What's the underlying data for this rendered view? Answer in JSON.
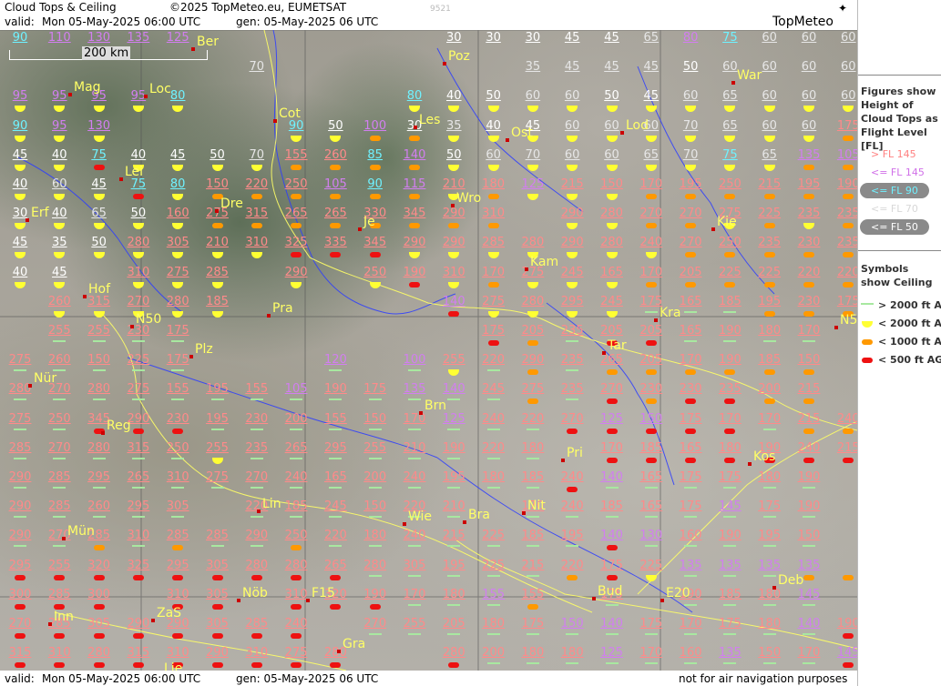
{
  "header": {
    "title": "Cloud Tops & Ceiling",
    "copyright": "©2025 TopMeteo.eu, EUMETSAT",
    "valid_label": "valid:",
    "valid_value": "Mon   05-May-2025  06:00 UTC",
    "gen": "gen: 05-May-2025 06 UTC",
    "code": "9521",
    "logo": "TopMeteo"
  },
  "footer": {
    "valid_label": "valid:",
    "valid_value": "Mon   05-May-2025   06:00 UTC",
    "gen": "gen: 05-May-2025 06 UTC",
    "disclaimer": "not for air navigation purposes"
  },
  "scale": {
    "label": "200 km"
  },
  "legend": {
    "fig_title": "Figures show Height of Cloud Tops as Flight Level  [FL]",
    "fl_entries": [
      {
        "label": "> FL 145",
        "color": "#ff8080",
        "pill": false
      },
      {
        "label": "<= FL 145",
        "color": "#d070e8",
        "pill": false
      },
      {
        "label": "<= FL 90",
        "color": "#70f0ff",
        "pill": true
      },
      {
        "label": "<= FL 70",
        "color": "#d8d8d8",
        "pill": false
      },
      {
        "label": "<= FL 50",
        "color": "#ffffff",
        "pill": true
      }
    ],
    "sym_title": "Symbols show Ceiling",
    "sym_entries": [
      {
        "label": "> 2000 ft AGL",
        "cls": "ge2000"
      },
      {
        "label": "< 2000 ft AGL",
        "cls": "lt2000"
      },
      {
        "label": "< 1000 ft AGL",
        "cls": "lt1000"
      },
      {
        "label": "< 500 ft AGL",
        "cls": "lt500"
      }
    ]
  },
  "colors": {
    "gt145": "#ff8a8a",
    "le145": "#d27ef0",
    "le90": "#6ff2ff",
    "le70": "#e6e6e6",
    "le50": "#ffffff",
    "city": "#ffff66"
  },
  "cities": [
    "Ber",
    "Poz",
    "War",
    "Mag",
    "Loc",
    "Cot",
    "Les",
    "Lod",
    "Ost",
    "Lei",
    "Wro",
    "Dre",
    "Je",
    "Kie",
    "Erf",
    "Kam",
    "Hof",
    "Pra",
    "Kra",
    "N50",
    "Plz",
    "Tar",
    "Nür",
    "Brn",
    "Reg",
    "Pri",
    "Kos",
    "Lin",
    "Mün",
    "Nit",
    "Wie",
    "Bra",
    "Deb",
    "Inn",
    "Nöb",
    "F15",
    "Bud",
    "E20",
    "ZaS",
    "Gra",
    "Lje",
    "N5"
  ],
  "grid_rows": [
    [
      "90 c",
      "110 p",
      "130 p",
      "135 p",
      "125 p",
      "",
      "",
      "",
      "",
      "",
      "",
      "30 w",
      "30 w",
      "30 w",
      "45 w",
      "45 w",
      "65 g",
      "80 p",
      "75 c",
      "60 g",
      "60 g",
      "60 g"
    ],
    [
      "",
      "",
      "",
      "",
      "",
      "",
      "70 g",
      "",
      "",
      "",
      "",
      "",
      "",
      "35 g",
      "45 g",
      "45 g",
      "45 g",
      "50 w",
      "60 g",
      "60 g",
      "60 g",
      "60 g"
    ],
    [
      "95 p",
      "95 p",
      "95 p",
      "95 p",
      "80 c",
      "",
      "",
      "",
      "",
      "",
      "80 c",
      "40 w",
      "50 w",
      "60 g",
      "60 g",
      "50 w",
      "45 w",
      "60 g",
      "65 g",
      "60 g",
      "60 g",
      "60 g"
    ],
    [
      "90 c",
      "95 p",
      "130 p",
      "",
      "",
      "",
      "",
      "90 c",
      "50 w",
      "100 p",
      "30 w",
      "35 g",
      "40 w",
      "45 w",
      "60 g",
      "60 g",
      "60 g",
      "70 g",
      "65 g",
      "60 g",
      "60 g",
      "175 r"
    ],
    [
      "45 w",
      "40 w",
      "75 c",
      "40 w",
      "45 w",
      "50 w",
      "70 g",
      "155 r",
      "260 r",
      "85 c",
      "140 p",
      "50 w",
      "60 g",
      "70 g",
      "60 g",
      "60 g",
      "65 g",
      "70 g",
      "75 c",
      "65 g",
      "135 p",
      "105 p"
    ],
    [
      "40 w",
      "60 g",
      "45 w",
      "75 c",
      "80 c",
      "150 r",
      "220 r",
      "250 r",
      "105 p",
      "90 c",
      "115 p",
      "210 r",
      "180 r",
      "125 p",
      "215 r",
      "150 r",
      "170 r",
      "195 r",
      "250 r",
      "215 r",
      "195 r",
      "190 r"
    ],
    [
      "30 w",
      "40 w",
      "65 g",
      "50 w",
      "160 r",
      "275 r",
      "315 r",
      "265 r",
      "265 r",
      "330 r",
      "345 r",
      "290 r",
      "310 r",
      "",
      "290 r",
      "280 r",
      "270 r",
      "270 r",
      "275 r",
      "225 r",
      "235 r",
      "235 r"
    ],
    [
      "45 w",
      "35 w",
      "50 w",
      "280 r",
      "305 r",
      "210 r",
      "310 r",
      "325 r",
      "335 r",
      "345 r",
      "290 r",
      "290 r",
      "285 r",
      "280 r",
      "290 r",
      "280 r",
      "240 r",
      "270 r",
      "250 r",
      "235 r",
      "230 r",
      "235 r"
    ],
    [
      "40 w",
      "45 w",
      "",
      "310 r",
      "275 r",
      "285 r",
      "",
      "290 r",
      "",
      "250 r",
      "190 r",
      "310 r",
      "170 r",
      "275 r",
      "245 r",
      "165 r",
      "170 r",
      "205 r",
      "225 r",
      "225 r",
      "220 r",
      "220 r"
    ],
    [
      "",
      "260 r",
      "315 r",
      "270 r",
      "280 r",
      "185 r",
      "",
      "",
      "",
      "",
      "",
      "140 p",
      "275 r",
      "280 r",
      "295 r",
      "245 r",
      "175 r",
      "165 r",
      "185 r",
      "195 r",
      "230 r",
      "175 r"
    ],
    [
      "",
      "255 r",
      "255 r",
      "230 r",
      "175 r",
      "",
      "",
      "",
      "",
      "",
      "",
      "",
      "175 r",
      "205 r",
      "235 r",
      "205 r",
      "205 r",
      "165 r",
      "190 r",
      "180 r",
      "170 r",
      ""
    ],
    [
      "275 r",
      "260 r",
      "150 r",
      "225 r",
      "175 r",
      "",
      "",
      "",
      "120 p",
      "",
      "100 p",
      "255 r",
      "220 r",
      "290 r",
      "235 r",
      "265 r",
      "205 r",
      "170 r",
      "190 r",
      "185 r",
      "150 r",
      ""
    ],
    [
      "280 r",
      "270 r",
      "280 r",
      "275 r",
      "155 r",
      "195 r",
      "155 r",
      "105 p",
      "190 r",
      "175 r",
      "135 p",
      "140 p",
      "245 r",
      "275 r",
      "235 r",
      "270 r",
      "230 r",
      "230 r",
      "235 r",
      "200 r",
      "215 r",
      ""
    ],
    [
      "275 r",
      "250 r",
      "345 r",
      "290 r",
      "230 r",
      "195 r",
      "230 r",
      "200 r",
      "155 r",
      "150 r",
      "170 r",
      "125 p",
      "240 r",
      "220 r",
      "270 r",
      "125 p",
      "150 p",
      "175 r",
      "170 r",
      "170 r",
      "215 r",
      "240 r"
    ],
    [
      "285 r",
      "270 r",
      "280 r",
      "315 r",
      "250 r",
      "255 r",
      "235 r",
      "265 r",
      "295 r",
      "255 r",
      "210 r",
      "190 r",
      "220 r",
      "180 r",
      "",
      "170 r",
      "185 r",
      "165 r",
      "180 r",
      "190 r",
      "240 r",
      "215 r"
    ],
    [
      "290 r",
      "285 r",
      "295 r",
      "265 r",
      "310 r",
      "275 r",
      "270 r",
      "240 r",
      "165 r",
      "200 r",
      "240 r",
      "195 r",
      "180 r",
      "185 r",
      "240 r",
      "140 p",
      "165 r",
      "175 r",
      "175 r",
      "180 r",
      "190 r",
      ""
    ],
    [
      "290 r",
      "285 r",
      "260 r",
      "295 r",
      "305 r",
      "",
      "220 r",
      "185 r",
      "245 r",
      "150 r",
      "220 r",
      "210 r",
      "",
      "170 r",
      "240 r",
      "185 r",
      "165 r",
      "175 r",
      "145 p",
      "175 r",
      "190 r",
      ""
    ],
    [
      "290 r",
      "270 r",
      "285 r",
      "310 r",
      "285 r",
      "285 r",
      "290 r",
      "250 r",
      "220 r",
      "180 r",
      "240 r",
      "215 r",
      "225 r",
      "185 r",
      "195 r",
      "140 p",
      "130 p",
      "160 r",
      "190 r",
      "195 r",
      "150 r",
      ""
    ],
    [
      "295 r",
      "255 r",
      "320 r",
      "325 r",
      "295 r",
      "305 r",
      "280 r",
      "280 r",
      "265 r",
      "280 r",
      "305 r",
      "195 r",
      "225 r",
      "215 r",
      "220 r",
      "175 r",
      "225 r",
      "135 p",
      "135 p",
      "135 p",
      "135 p",
      ""
    ],
    [
      "300 r",
      "285 r",
      "300 r",
      "",
      "310 r",
      "305 r",
      "",
      "310 r",
      "320 r",
      "190 r",
      "170 r",
      "180 r",
      "155 p",
      "155 r",
      "",
      "175 r",
      "",
      "190 r",
      "185 r",
      "180 r",
      "145 p",
      ""
    ],
    [
      "270 r",
      "285 r",
      "305 r",
      "290 r",
      "290 r",
      "305 r",
      "285 r",
      "240 r",
      "",
      "270 r",
      "255 r",
      "205 r",
      "180 r",
      "175 r",
      "150 p",
      "140 p",
      "175 r",
      "170 r",
      "175 r",
      "180 r",
      "140 p",
      "190 r"
    ],
    [
      "315 r",
      "310 r",
      "280 r",
      "315 r",
      "310 r",
      "290 r",
      "310 r",
      "275 r",
      "280 r",
      "",
      "",
      "280 r",
      "200 r",
      "180 r",
      "180 r",
      "125 p",
      "170 r",
      "160 r",
      "135 p",
      "150 r",
      "170 r",
      "145 p"
    ]
  ],
  "grid_symbols": [
    "",
    "",
    "",
    "",
    "",
    "",
    "",
    "",
    "",
    "",
    "",
    "",
    "",
    "",
    "",
    "",
    "",
    "",
    "",
    "",
    "",
    "",
    "",
    "",
    "",
    "",
    "",
    "",
    "",
    "",
    "",
    "",
    "",
    "",
    "",
    "",
    "",
    "",
    "",
    "",
    "",
    "",
    "",
    "",
    "y",
    "y",
    "y",
    "y",
    "y",
    "",
    "",
    "",
    "",
    "",
    "y",
    "y",
    "y",
    "y",
    "y",
    "y",
    "y",
    "y",
    "y",
    "y",
    "y",
    "y",
    "y",
    "y",
    "y",
    "",
    "",
    "",
    "",
    "y",
    "y",
    "o",
    "o",
    "y",
    "y",
    "y",
    "y",
    "y",
    "y",
    "y",
    "y",
    "y",
    "y",
    "o",
    "y",
    "y",
    "r",
    "y",
    "y",
    "y",
    "y",
    "o",
    "o",
    "o",
    "o",
    "y",
    "y",
    "y",
    "y",
    "y",
    "y",
    "y",
    "y",
    "y",
    "o",
    "o",
    "y",
    "y",
    "y",
    "r",
    "y",
    "o",
    "o",
    "o",
    "o",
    "o",
    "o",
    "y",
    "o",
    "y",
    "y",
    "y",
    "o",
    "o",
    "o",
    "o",
    "o",
    "o",
    "y",
    "y",
    "y",
    "y",
    "y",
    "o",
    "o",
    "o",
    "o",
    "o",
    "o",
    "o",
    "o",
    "",
    "y",
    "y",
    "o",
    "o",
    "y",
    "o",
    "y",
    "o",
    "y",
    "y",
    "y",
    "y",
    "y",
    "y",
    "y",
    "r",
    "r",
    "r",
    "y",
    "y",
    "y",
    "y",
    "y",
    "y",
    "y",
    "o",
    "o",
    "o",
    "o",
    "o",
    "y",
    "y",
    "",
    "y",
    "y",
    "y",
    "",
    "y",
    "",
    "y",
    "r",
    "y",
    "o",
    "y",
    "y",
    "y",
    "o",
    "o",
    "o",
    "o",
    "o",
    "o",
    "",
    "y",
    "y",
    "y",
    "y",
    "y",
    "",
    "",
    "",
    "",
    "",
    "r",
    "y",
    "y",
    "y",
    "y",
    "g",
    "g",
    "g",
    "o",
    "o",
    "o",
    "",
    "g",
    "g",
    "g",
    "g",
    "",
    "",
    "",
    "",
    "",
    "",
    "",
    "r",
    "o",
    "g",
    "r",
    "r",
    "g",
    "g",
    "g",
    "g",
    "",
    "g",
    "g",
    "g",
    "g",
    "g",
    "",
    "",
    "",
    "g",
    "",
    "g",
    "y",
    "g",
    "o",
    "g",
    "o",
    "o",
    "o",
    "o",
    "o",
    "o",
    "",
    "g",
    "g",
    "g",
    "g",
    "g",
    "g",
    "g",
    "g",
    "g",
    "g",
    "g",
    "g",
    "g",
    "o",
    "g",
    "r",
    "o",
    "r",
    "r",
    "o",
    "o",
    "",
    "g",
    "g",
    "r",
    "r",
    "r",
    "g",
    "g",
    "g",
    "g",
    "g",
    "g",
    "g",
    "g",
    "g",
    "r",
    "r",
    "r",
    "r",
    "r",
    "g",
    "o",
    "o",
    "g",
    "g",
    "g",
    "g",
    "g",
    "y",
    "g",
    "g",
    "g",
    "g",
    "g",
    "g",
    "g",
    "g",
    "",
    "r",
    "r",
    "r",
    "r",
    "r",
    "r",
    "r",
    "g",
    "g",
    "g",
    "g",
    "g",
    "g",
    "g",
    "g",
    "g",
    "g",
    "g",
    "g",
    "g",
    "g",
    "r",
    "g",
    "g",
    "g",
    "g",
    "g",
    "g",
    "",
    "g",
    "g",
    "g",
    "g",
    "g",
    "",
    "g",
    "g",
    "g",
    "g",
    "g",
    "g",
    "",
    "g",
    "g",
    "g",
    "g",
    "g",
    "g",
    "g",
    "g",
    "",
    "g",
    "g",
    "o",
    "g",
    "o",
    "g",
    "g",
    "o",
    "g",
    "g",
    "g",
    "g",
    "g",
    "g",
    "g",
    "r",
    "g",
    "g",
    "g",
    "g",
    "g",
    "",
    "r",
    "r",
    "r",
    "r",
    "r",
    "r",
    "r",
    "r",
    "r",
    "g",
    "g",
    "g",
    "g",
    "g",
    "o",
    "r",
    "y",
    "g",
    "g",
    "g",
    "o",
    "o",
    "r",
    "r",
    "r",
    "",
    "r",
    "r",
    "",
    "r",
    "r",
    "r",
    "g",
    "g",
    "g",
    "o",
    "",
    "g",
    "",
    "g",
    "g",
    "g",
    "g",
    "",
    "r",
    "r",
    "r",
    "r",
    "r",
    "r",
    "r",
    "r",
    "",
    "g",
    "g",
    "g",
    "g",
    "g",
    "g",
    "g",
    "g",
    "g",
    "g",
    "g",
    "g",
    "r",
    "r",
    "r",
    "r",
    "r",
    "r",
    "r",
    "r",
    "r",
    "r",
    "",
    "",
    "r",
    "g",
    "g",
    "g",
    "g",
    "g",
    "g",
    "g",
    "g",
    "g",
    "r"
  ]
}
